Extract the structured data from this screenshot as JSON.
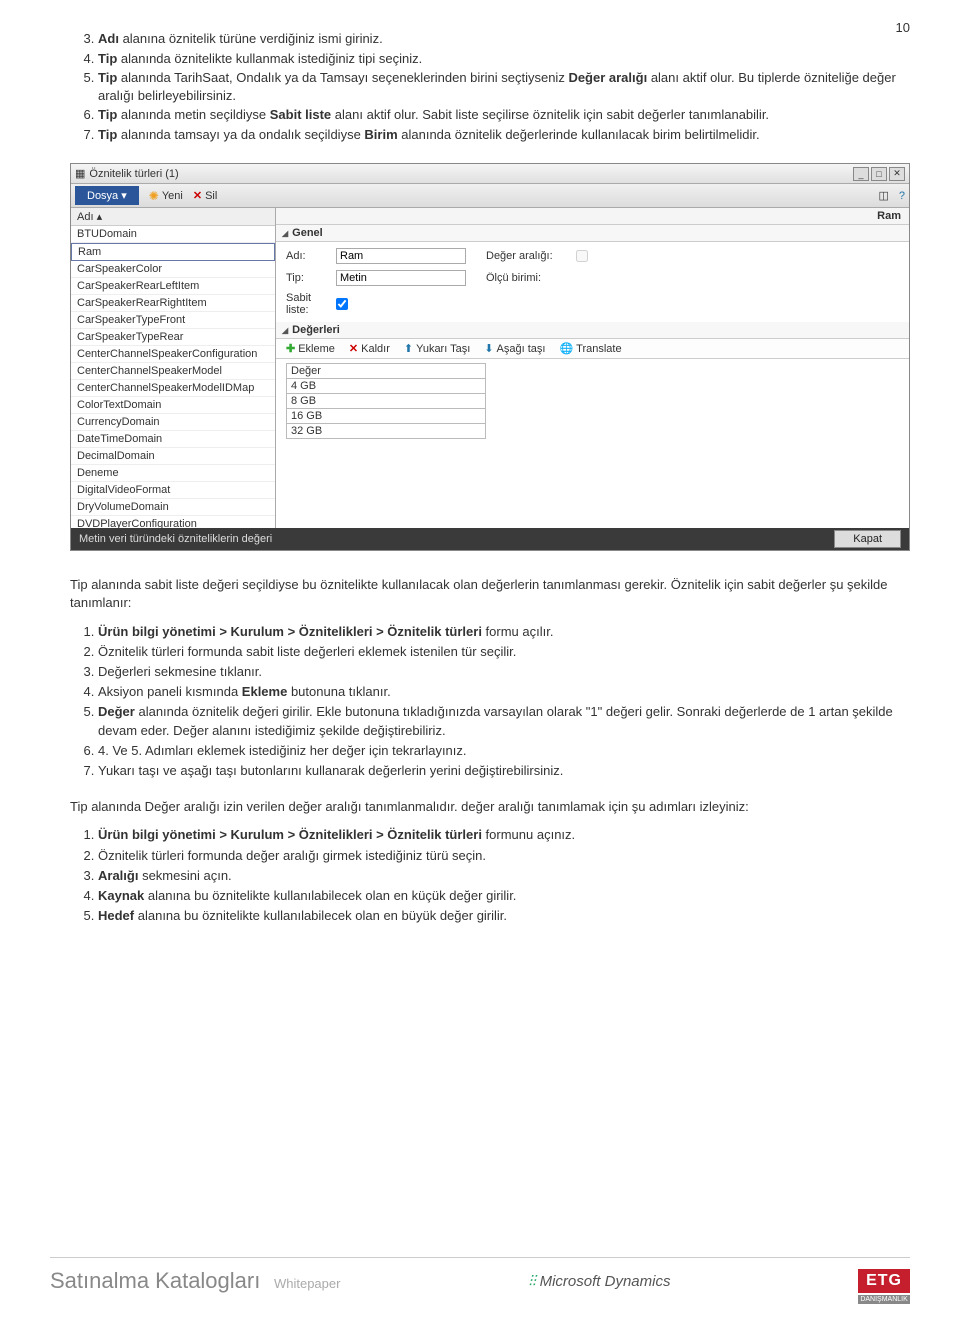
{
  "pageNumber": "10",
  "topList": [
    {
      "num": "3.",
      "pre": "Adı",
      "post": " alanına öznitelik türüne verdiğiniz ismi giriniz."
    },
    {
      "num": "4.",
      "pre": "Tip",
      "post": " alanında öznitelikte kullanmak istediğiniz tipi seçiniz."
    },
    {
      "num": "5.",
      "pre": "Tip",
      "mid": " alanında TarihSaat, Ondalık ya da Tamsayı seçeneklerinden birini seçtiyseniz ",
      "bold2": "Değer aralığı",
      "post": " alanı aktif olur. Bu tiplerde özniteliğe değer aralığı belirleyebilirsiniz."
    },
    {
      "num": "6.",
      "pre": "Tip",
      "mid": " alanında metin seçildiyse ",
      "bold2": "Sabit liste",
      "post": " alanı aktif olur. Sabit liste seçilirse öznitelik için sabit değerler tanımlanabilir."
    },
    {
      "num": "7.",
      "pre": "Tip",
      "mid": " alanında tamsayı ya da ondalık seçildiyse ",
      "bold2": "Birim",
      "post": " alanında öznitelik değerlerinde kullanılacak birim belirtilmelidir."
    }
  ],
  "app": {
    "title": "Öznitelik türleri (1)",
    "fileMenu": "Dosya",
    "yeni": "Yeni",
    "sil": "Sil",
    "colAdi": "Adı",
    "selectedRight": "Ram",
    "listItems": [
      "BTUDomain",
      "Ram",
      "CarSpeakerColor",
      "CarSpeakerRearLeftItem",
      "CarSpeakerRearRightItem",
      "CarSpeakerTypeFront",
      "CarSpeakerTypeRear",
      "CenterChannelSpeakerConfiguration",
      "CenterChannelSpeakerModel",
      "CenterChannelSpeakerModelIDMap",
      "ColorTextDomain",
      "CurrencyDomain",
      "DateTimeDomain",
      "DecimalDomain",
      "Deneme",
      "DigitalVideoFormat",
      "DryVolumeDomain",
      "DVDPlayerConfiguration"
    ],
    "genel": {
      "hdr": "Genel",
      "adiLbl": "Adı:",
      "adiVal": "Ram",
      "tipLbl": "Tip:",
      "tipVal": "Metin",
      "degerLbl": "Değer aralığı:",
      "olcuLbl": "Ölçü birimi:",
      "sabitLbl": "Sabit liste:"
    },
    "degerleri": {
      "hdr": "Değerleri",
      "ekleme": "Ekleme",
      "kaldir": "Kaldır",
      "yukari": "Yukarı Taşı",
      "asagi": "Aşağı taşı",
      "translate": "Translate",
      "colDeger": "Değer",
      "rows": [
        "4 GB",
        "8 GB",
        "16 GB",
        "32 GB"
      ]
    },
    "status": "Metin veri türündeki özniteliklerin değeri",
    "kapat": "Kapat"
  },
  "para1": "Tip alanında sabit liste değeri seçildiyse bu öznitelikte kullanılacak olan değerlerin tanımlanması gerekir. Öznitelik için sabit değerler şu şekilde tanımlanır:",
  "list1": [
    {
      "b": "Ürün bilgi yönetimi > Kurulum > Öznitelikleri > Öznitelik türleri",
      "t": " formu açılır."
    },
    {
      "t": "Öznitelik türleri formunda sabit liste değerleri eklemek istenilen tür seçilir."
    },
    {
      "t": "Değerleri sekmesine tıklanır."
    },
    {
      "pre": "Aksiyon paneli kısmında ",
      "b": "Ekleme",
      "t": " butonuna tıklanır."
    },
    {
      "b": "Değer",
      "t": " alanında öznitelik değeri girilir. Ekle butonuna tıkladığınızda varsayılan olarak \"1\" değeri gelir. Sonraki değerlerde de 1 artan şekilde devam eder. Değer alanını istediğimiz şekilde değiştirebiliriz."
    },
    {
      "t": "4. Ve 5. Adımları eklemek istediğiniz her değer için tekrarlayınız."
    },
    {
      "t": "Yukarı taşı ve aşağı taşı butonlarını kullanarak değerlerin yerini değiştirebilirsiniz."
    }
  ],
  "para2": "Tip alanında Değer aralığı izin verilen değer aralığı tanımlanmalıdır. değer aralığı tanımlamak için şu adımları izleyiniz:",
  "list2": [
    {
      "b": "Ürün bilgi yönetimi > Kurulum > Öznitelikleri > Öznitelik türleri",
      "t": " formunu açınız."
    },
    {
      "t": "Öznitelik türleri formunda değer aralığı girmek istediğiniz türü seçin."
    },
    {
      "b": "Aralığı",
      "t": " sekmesini açın."
    },
    {
      "b": "Kaynak",
      "t": " alanına bu öznitelikte kullanılabilecek olan en küçük değer girilir."
    },
    {
      "b": "Hedef",
      "t": " alanına bu öznitelikte kullanılabilecek olan en büyük değer girilir."
    }
  ],
  "footer": {
    "title": "Satınalma Katalogları",
    "wp": "Whitepaper",
    "msd": "Microsoft Dynamics",
    "etg": "ETG",
    "etgsub": "DANIŞMANLIK"
  }
}
